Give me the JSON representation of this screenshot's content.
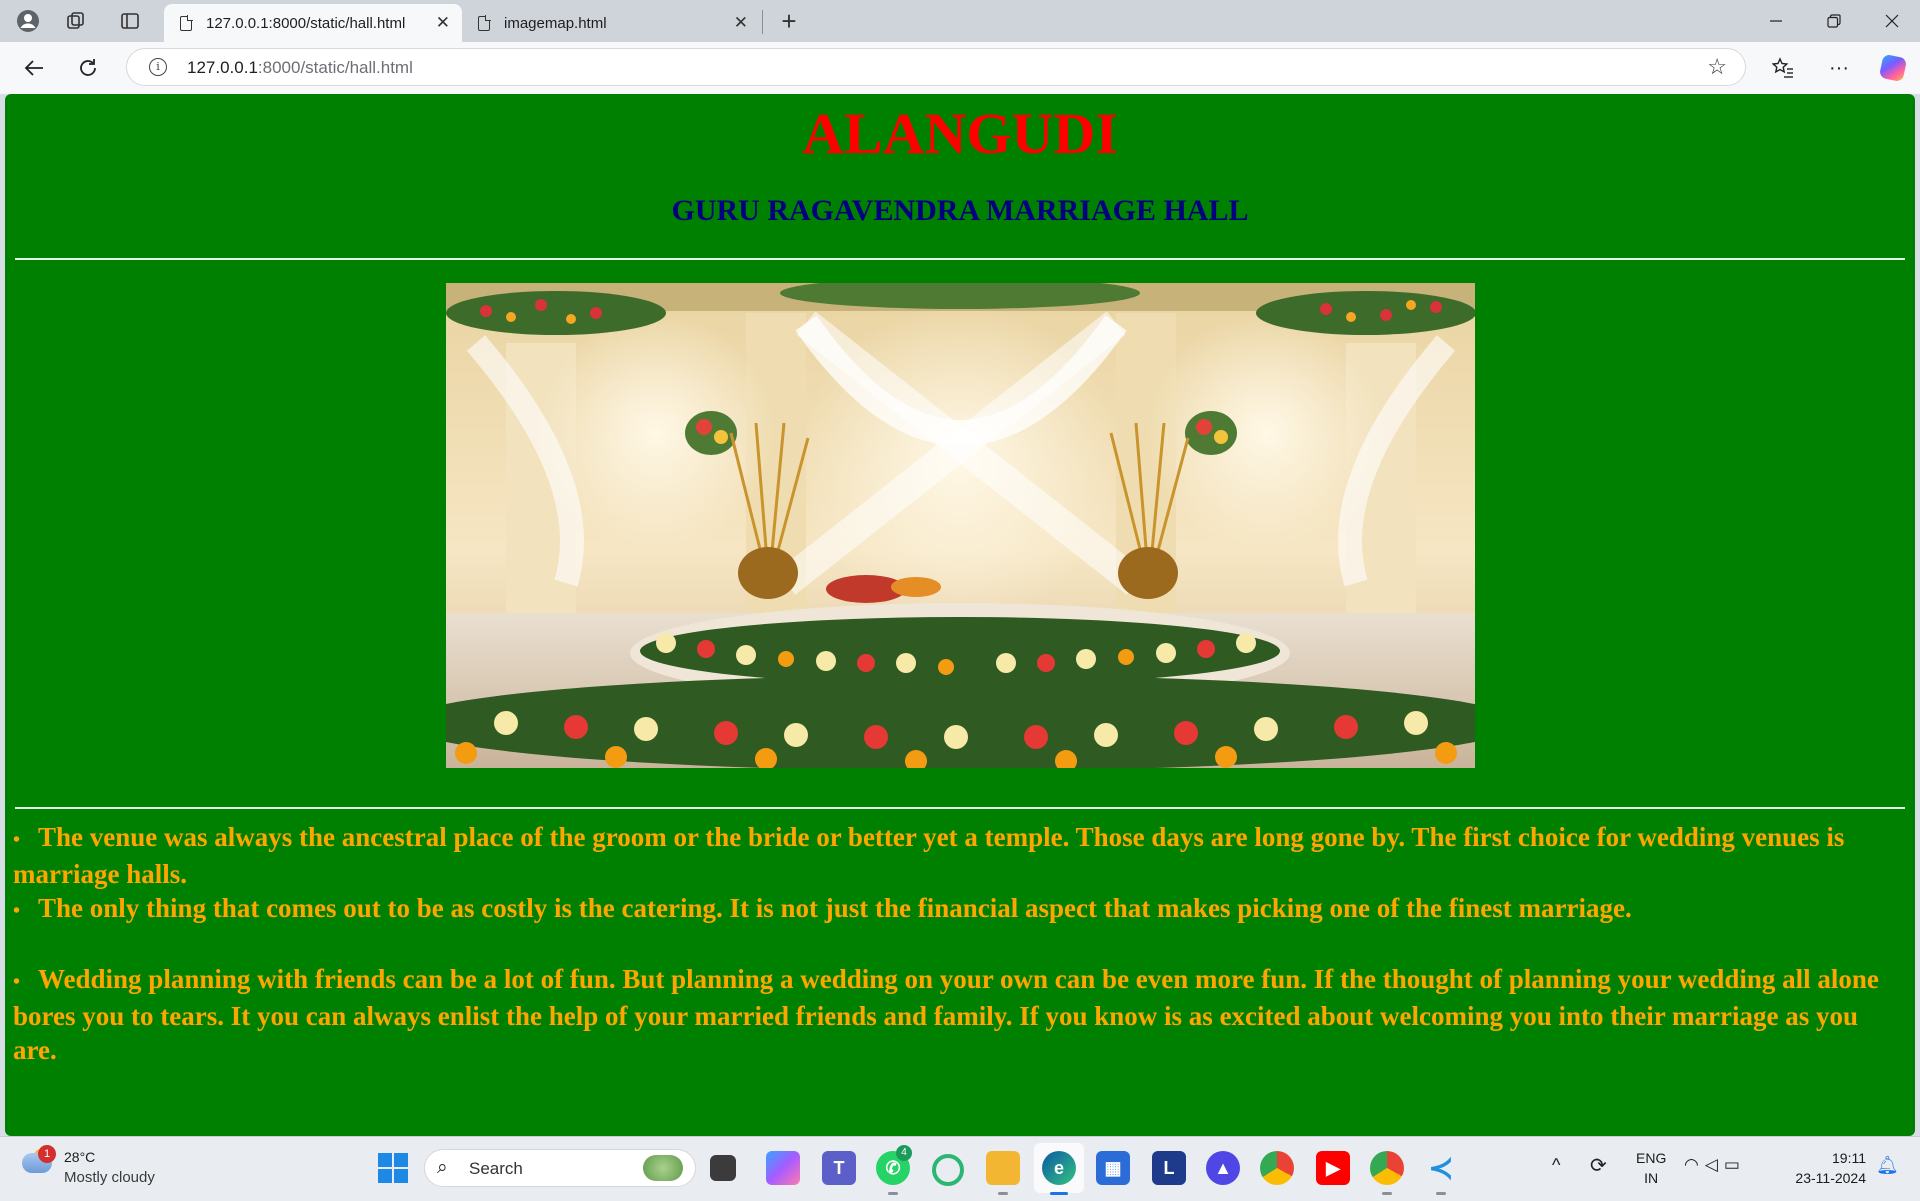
{
  "browser": {
    "tabs": [
      {
        "title": "127.0.0.1:8000/static/hall.html",
        "active": true
      },
      {
        "title": "imagemap.html",
        "active": false
      }
    ],
    "url": {
      "host": "127.0.0.1",
      "rest": ":8000/static/hall.html"
    }
  },
  "page": {
    "title": "ALANGUDI",
    "subtitle": "GURU RAGAVENDRA MARRIAGE HALL",
    "colors": {
      "background": "#008000",
      "title": "#ff0000",
      "subtitle": "#000080",
      "body_text": "#ffa500"
    },
    "bullets": [
      "The venue was always the ancestral place of the groom or the bride or better yet a temple. Those days are long gone by. The first choice for wedding venues is marriage halls.",
      "The only thing that comes out to be as costly is the catering. It is not just the financial aspect that makes picking one of the finest marriage.",
      "Wedding planning with friends can be a lot of fun. But planning a wedding on your own can be even more fun. If the thought of planning your wedding all alone bores you to tears. It you can always enlist the help of your married friends and family. If you know is as excited about welcoming you into their marriage as you are."
    ]
  },
  "taskbar": {
    "weather": {
      "temp": "28°C",
      "condition": "Mostly cloudy",
      "badge": "1"
    },
    "search_label": "Search",
    "whatsapp_badge": "4",
    "lang_line1": "ENG",
    "lang_line2": "IN",
    "time": "19:11",
    "date": "23-11-2024"
  }
}
